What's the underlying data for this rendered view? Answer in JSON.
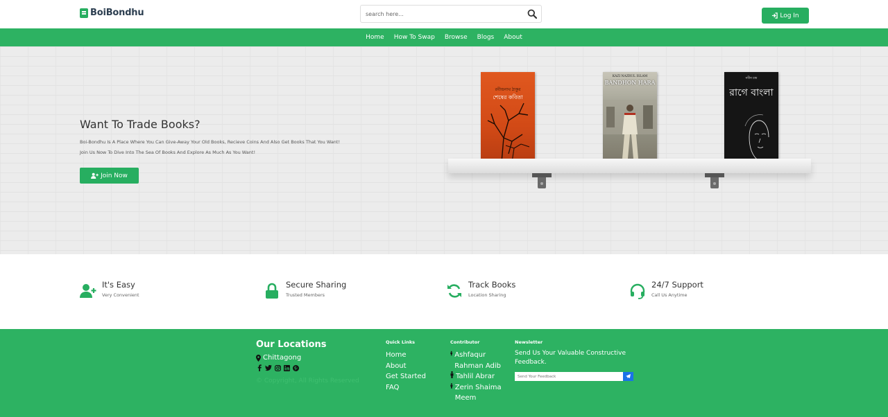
{
  "header": {
    "brand": "BoiBondhu",
    "search_placeholder": "search here...",
    "login_label": "Log In"
  },
  "nav": {
    "items": [
      "Home",
      "How To Swap",
      "Browse",
      "Blogs",
      "About"
    ]
  },
  "hero": {
    "title": "Want To Trade Books?",
    "desc_line1": "Boi-Bondhu Is A Place Where You Can Give-Away Your Old Books, Recieve Coins And Also Get Books That You Want!",
    "desc_line2": "Join Us Now To Dive Into The Sea Of Books And Explore As Much As You Want!",
    "join_label": "Join Now",
    "books": [
      {
        "caption": "শেষের কবিতা"
      },
      {
        "caption": "BANDHON HARA",
        "author": "KAZI NAZRUL ISLAM"
      },
      {
        "caption": "রাগে বাংলা"
      }
    ]
  },
  "features": [
    {
      "title": "It's Easy",
      "subtitle": "Very Convenient",
      "icon": "user-plus-icon"
    },
    {
      "title": "Secure Sharing",
      "subtitle": "Trusted Members",
      "icon": "lock-icon"
    },
    {
      "title": "Track Books",
      "subtitle": "Location Sharing",
      "icon": "sync-icon"
    },
    {
      "title": "24/7 Support",
      "subtitle": "Call Us Anytime",
      "icon": "headset-icon"
    }
  ],
  "footer": {
    "locations_title": "Our Locations",
    "city": "Chittagong",
    "copyright": "© Copyright, All Rights Reserved",
    "quick_links_title": "Quick Links",
    "quick_links": [
      "Home",
      "About",
      "Get Started",
      "FAQ"
    ],
    "contributor_title": "Contributor",
    "contributors": [
      "Ashfaqur Rahman Adib",
      "Tahlil Abrar",
      "Zerin Shaima Meem"
    ],
    "newsletter_title": "Newsletter",
    "newsletter_text": "Send Us Your Valuable Constructive Feedback.",
    "feedback_placeholder": "Send Your Feedback"
  },
  "colors": {
    "primary": "#27ae60",
    "nav": "#2db262",
    "send_button": "#1a73e8"
  }
}
